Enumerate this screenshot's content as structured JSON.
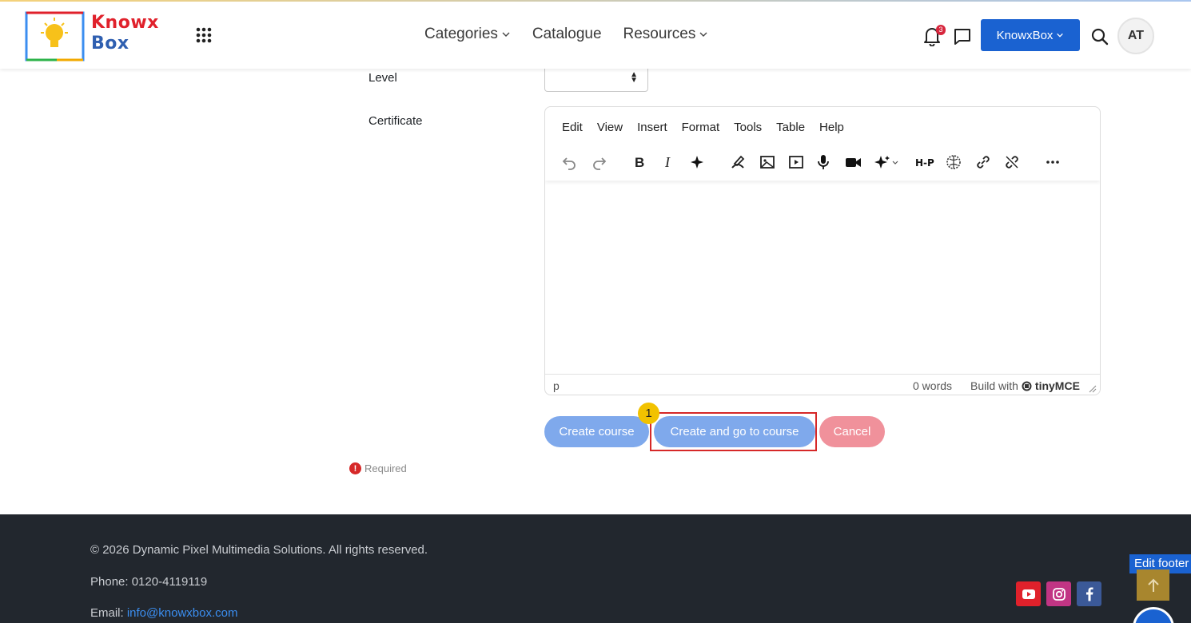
{
  "header": {
    "logo_line1": "Knowx",
    "logo_line2": "Box",
    "nav": [
      "Categories",
      "Catalogue",
      "Resources"
    ],
    "notification_count": "3",
    "org_button": "KnowxBox",
    "avatar_initials": "AT"
  },
  "form": {
    "level_label": "Level",
    "certificate_label": "Certificate",
    "editor": {
      "menu": [
        "Edit",
        "View",
        "Insert",
        "Format",
        "Tools",
        "Table",
        "Help"
      ],
      "status_path": "p",
      "word_count": "0 words",
      "build_with": "Build with",
      "brand": "tinyMCE"
    },
    "buttons": {
      "create": "Create course",
      "create_go": "Create and go to course",
      "cancel": "Cancel"
    },
    "step_badge": "1",
    "required_icon": "!",
    "required_text": "Required"
  },
  "footer": {
    "copyright": "© 2026 Dynamic Pixel Multimedia Solutions. All rights reserved.",
    "phone": "Phone: 0120-4119119",
    "email_prefix": "Email: ",
    "email": "info@knowxbox.com",
    "edit_footer": "Edit footer"
  },
  "colors": {
    "primary": "#1a62d1",
    "button_light": "#7fa9ec",
    "cancel": "#f0919b",
    "footer_bg": "#22272e",
    "highlight": "#d62828",
    "badge": "#f2c200"
  }
}
